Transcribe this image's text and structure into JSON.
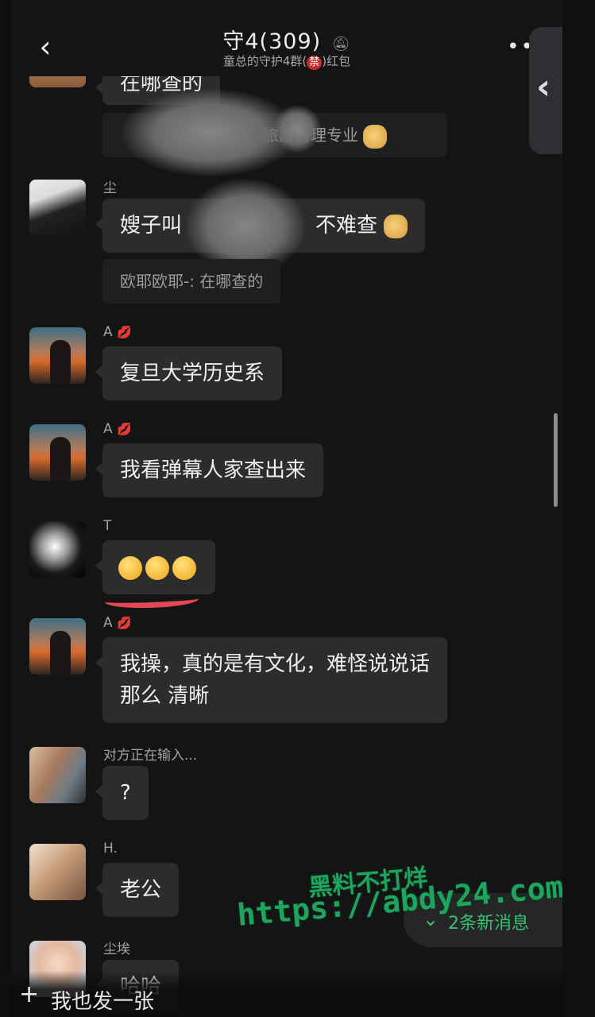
{
  "header": {
    "back_icon": "chevron-left-icon",
    "title": "守4(309)",
    "mute_icon": "bell-off-icon",
    "subtitle_prefix": "童总的守护4群(",
    "subtitle_badge": "禁",
    "subtitle_suffix": ")红包",
    "more_icon": "more-dots-icon"
  },
  "side_panel": {
    "icon": "chevron-left-icon"
  },
  "messages": [
    {
      "sender": "",
      "text": "在哪查的",
      "avatar": "partial-avatar"
    },
    {
      "sender": "",
      "quote": "旅游管理专业",
      "emoji": "doge-emoji"
    },
    {
      "sender": "尘",
      "text_start": "嫂子叫",
      "text_end": "不难查",
      "emoji": "doge-emoji",
      "quote": "欧耶欧耶-:  在哪查的"
    },
    {
      "sender": "A",
      "badge": "lips-emoji",
      "text": "复旦大学历史系"
    },
    {
      "sender": "A",
      "badge": "lips-emoji",
      "text": "我看弹幕人家查出来"
    },
    {
      "sender": "T",
      "emojis": [
        "pensive-face",
        "relieved-face",
        "broken-heart-face"
      ]
    },
    {
      "sender": "A",
      "badge": "lips-emoji",
      "line1": "我操，真的是有文化，难怪说说话",
      "line2": "那么 清晰"
    },
    {
      "sender": "对方正在输入...",
      "text": "?"
    },
    {
      "sender": "H.",
      "text": "老公"
    },
    {
      "sender": "尘埃",
      "text": "哈哈"
    }
  ],
  "new_messages": {
    "icon": "double-chevron-down-icon",
    "label": "2条新消息"
  },
  "bottom": {
    "icon": "plus-icon",
    "label": "我也发一张"
  },
  "watermark": {
    "line1": "黑料不打烊",
    "line2": "https://abdy24.com"
  },
  "colors": {
    "background": "#141414",
    "bubble": "#2c2c2c",
    "accent_green": "#35c076",
    "badge_red": "#c42a2a"
  }
}
